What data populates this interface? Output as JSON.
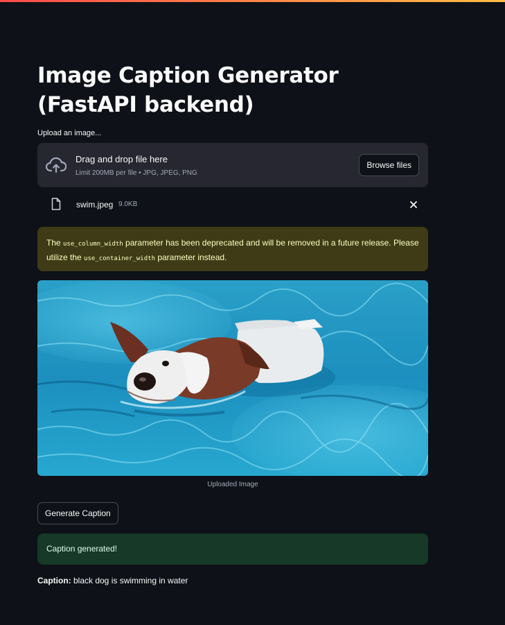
{
  "app": {
    "title": "Image Caption Generator (FastAPI backend)"
  },
  "uploader": {
    "label": "Upload an image...",
    "drop_text": "Drag and drop file here",
    "limit_text": "Limit 200MB per file • JPG, JPEG, PNG",
    "browse_label": "Browse files",
    "file": {
      "name": "swim.jpeg",
      "size": "9.0KB"
    }
  },
  "warning": {
    "part1": "The ",
    "code1": "use_column_width",
    "part2": " parameter has been deprecated and will be removed in a future release. Please utilize the ",
    "code2": "use_container_width",
    "part3": " parameter instead."
  },
  "image": {
    "caption": "Uploaded Image"
  },
  "actions": {
    "generate_label": "Generate Caption"
  },
  "status": {
    "success_text": "Caption generated!"
  },
  "result": {
    "label": "Caption:",
    "text": " black dog is swimming in water"
  },
  "colors": {
    "background": "#0e1117",
    "dropzone": "#262730",
    "warning_bg": "#3e3b16",
    "success_bg": "#173928",
    "accent": "#ff4b4b"
  }
}
